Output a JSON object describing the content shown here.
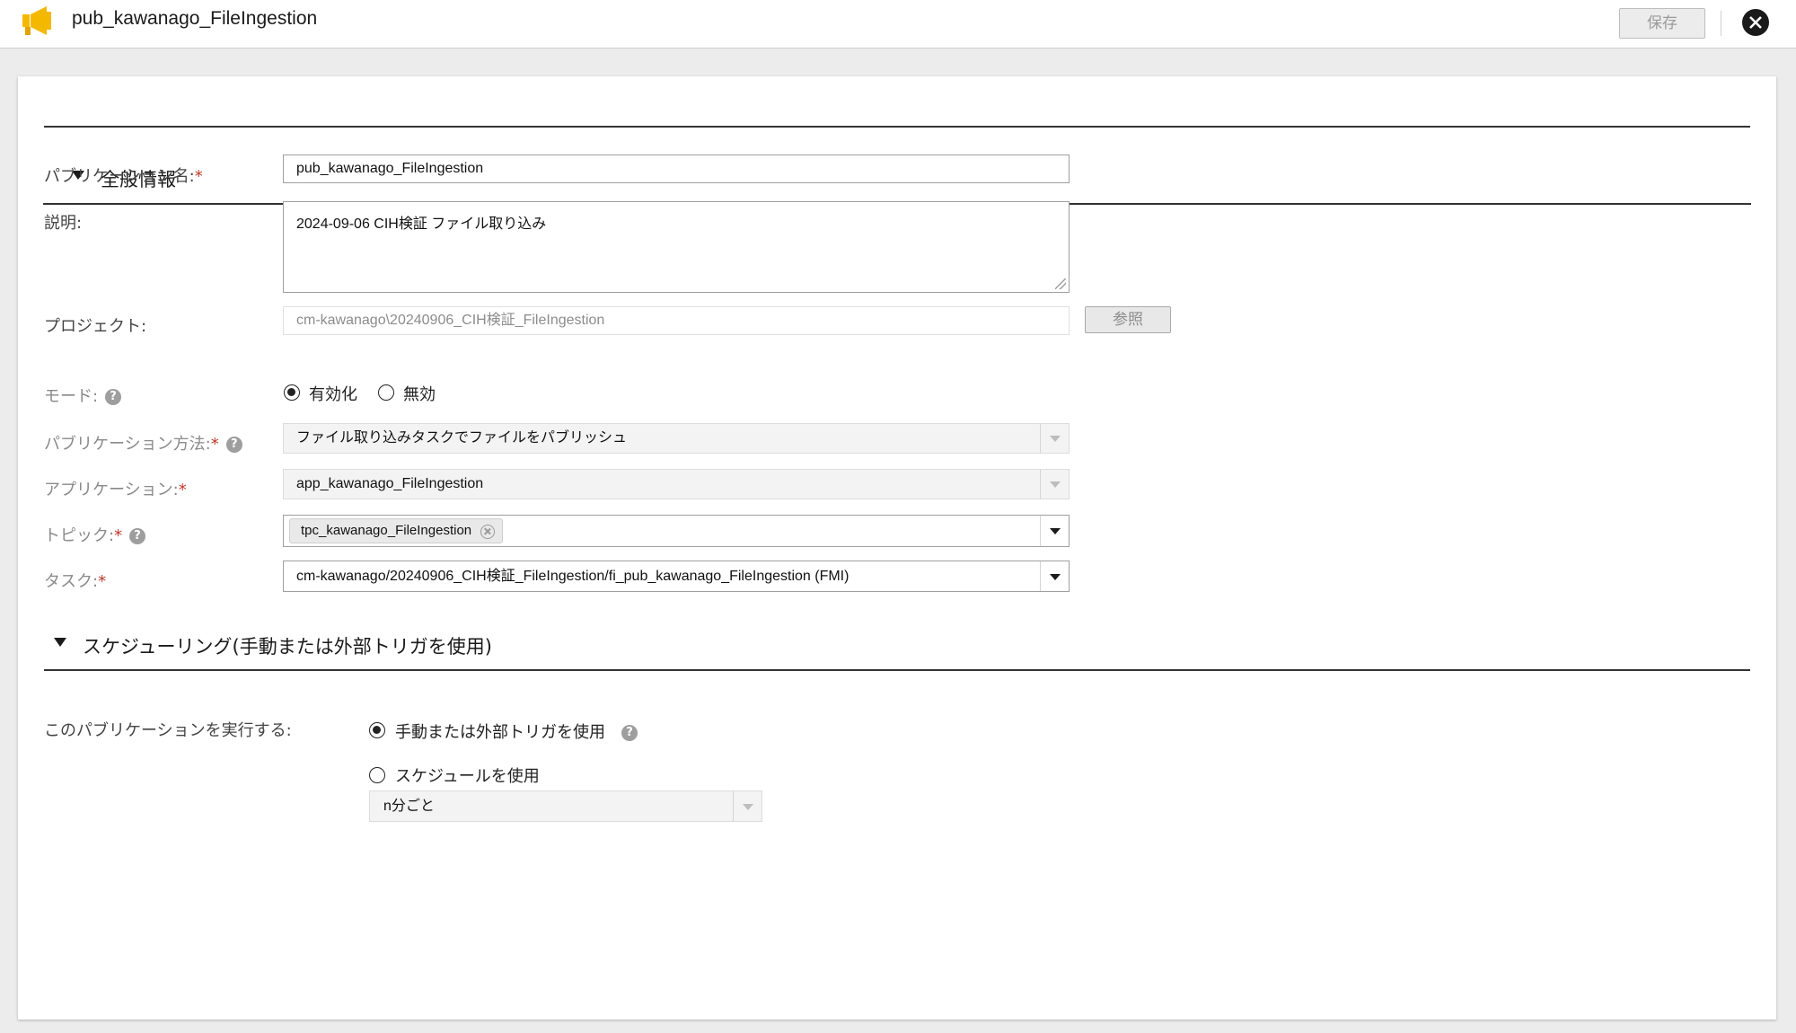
{
  "header": {
    "title": "pub_kawanago_FileIngestion",
    "save_label": "保存"
  },
  "general": {
    "section_title": "全般情報",
    "publication_name": {
      "label": "パブリケーション名:",
      "required": "*",
      "value": "pub_kawanago_FileIngestion"
    },
    "description": {
      "label": "説明:",
      "value": "2024-09-06 CIH検証 ファイル取り込み"
    },
    "project": {
      "label": "プロジェクト:",
      "value": "cm-kawanago\\20240906_CIH検証_FileIngestion",
      "browse_label": "参照"
    },
    "mode": {
      "label": "モード:",
      "options": [
        "有効化",
        "無効"
      ],
      "selected": "有効化"
    },
    "publication_method": {
      "label": "パブリケーション方法:",
      "required": "*",
      "value": "ファイル取り込みタスクでファイルをパブリッシュ"
    },
    "application": {
      "label": "アプリケーション:",
      "required": "*",
      "value": "app_kawanago_FileIngestion"
    },
    "topic": {
      "label": "トピック:",
      "required": "*",
      "chip": "tpc_kawanago_FileIngestion"
    },
    "task": {
      "label": "タスク:",
      "required": "*",
      "value": "cm-kawanago/20240906_CIH検証_FileIngestion/fi_pub_kawanago_FileIngestion (FMI)"
    }
  },
  "scheduling": {
    "section_title": "スケジューリング(手動または外部トリガを使用)",
    "run_label": "このパブリケーションを実行する:",
    "options": [
      "手動または外部トリガを使用",
      "スケジュールを使用"
    ],
    "selected": "手動または外部トリガを使用",
    "schedule_value": "n分ごと"
  },
  "colors": {
    "required": "#c0392b",
    "logo": "#f5b800"
  }
}
